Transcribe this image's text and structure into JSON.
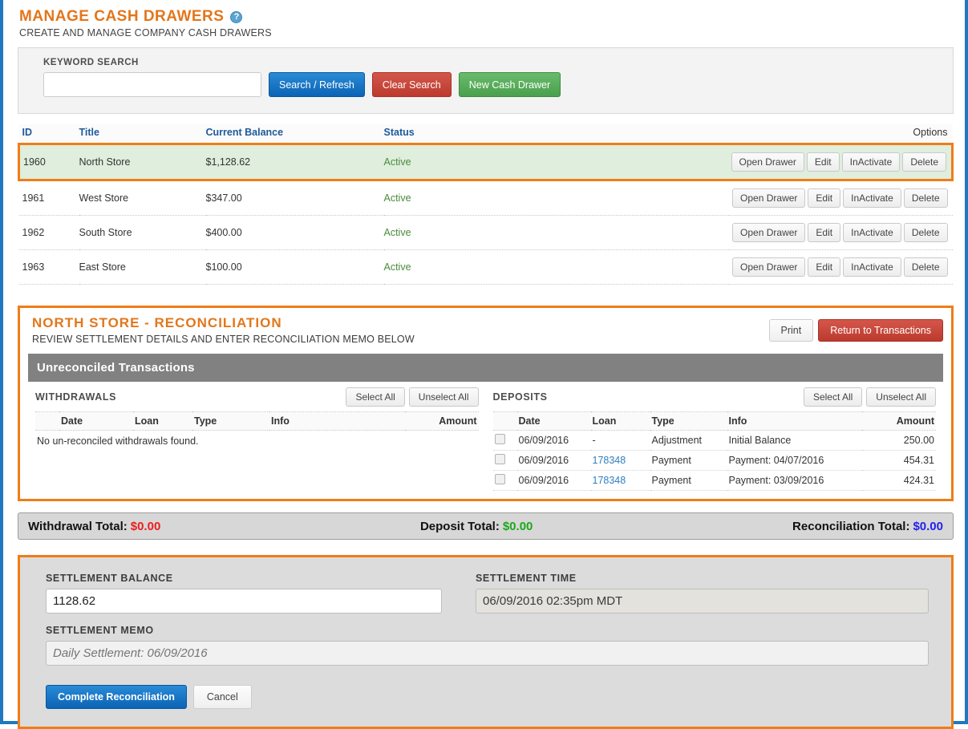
{
  "header": {
    "title": "MANAGE CASH DRAWERS",
    "help_icon": "help-circle-icon",
    "subtitle": "CREATE AND MANAGE COMPANY CASH DRAWERS"
  },
  "search": {
    "label": "KEYWORD SEARCH",
    "value": "",
    "placeholder": "",
    "buttons": {
      "search": "Search / Refresh",
      "clear": "Clear Search",
      "new": "New Cash Drawer"
    }
  },
  "drawers_table": {
    "columns": [
      "ID",
      "Title",
      "Current Balance",
      "Status",
      "Options"
    ],
    "row_actions": [
      "Open Drawer",
      "Edit",
      "InActivate",
      "Delete"
    ],
    "rows": [
      {
        "id": "1960",
        "title": "North Store",
        "balance": "$1,128.62",
        "status": "Active",
        "selected": true
      },
      {
        "id": "1961",
        "title": "West Store",
        "balance": "$347.00",
        "status": "Active",
        "selected": false
      },
      {
        "id": "1962",
        "title": "South Store",
        "balance": "$400.00",
        "status": "Active",
        "selected": false
      },
      {
        "id": "1963",
        "title": "East Store",
        "balance": "$100.00",
        "status": "Active",
        "selected": false
      }
    ]
  },
  "reconciliation": {
    "title": "NORTH STORE - RECONCILIATION",
    "subtitle": "REVIEW SETTLEMENT DETAILS AND ENTER RECONCILIATION MEMO BELOW",
    "print_label": "Print",
    "return_label": "Return to Transactions",
    "section_header": "Unreconciled Transactions",
    "withdrawals": {
      "title": "WITHDRAWALS",
      "select_all": "Select All",
      "unselect_all": "Unselect All",
      "columns": [
        "Date",
        "Loan",
        "Type",
        "Info",
        "Amount"
      ],
      "empty_message": "No un-reconciled withdrawals found.",
      "rows": []
    },
    "deposits": {
      "title": "DEPOSITS",
      "select_all": "Select All",
      "unselect_all": "Unselect All",
      "columns": [
        "Date",
        "Loan",
        "Type",
        "Info",
        "Amount"
      ],
      "rows": [
        {
          "checked": false,
          "date": "06/09/2016",
          "loan": "-",
          "loan_link": false,
          "type": "Adjustment",
          "info": "Initial Balance",
          "amount": "250.00"
        },
        {
          "checked": false,
          "date": "06/09/2016",
          "loan": "178348",
          "loan_link": true,
          "type": "Payment",
          "info": "Payment: 04/07/2016",
          "amount": "454.31"
        },
        {
          "checked": false,
          "date": "06/09/2016",
          "loan": "178348",
          "loan_link": true,
          "type": "Payment",
          "info": "Payment: 03/09/2016",
          "amount": "424.31"
        }
      ]
    }
  },
  "totals": {
    "withdrawal_label": "Withdrawal Total:",
    "withdrawal_value": "$0.00",
    "deposit_label": "Deposit Total:",
    "deposit_value": "$0.00",
    "reconciliation_label": "Reconciliation Total:",
    "reconciliation_value": "$0.00"
  },
  "settlement": {
    "balance_label": "SETTLEMENT BALANCE",
    "balance_value": "1128.62",
    "time_label": "SETTLEMENT TIME",
    "time_value": "06/09/2016 02:35pm MDT",
    "memo_label": "SETTLEMENT MEMO",
    "memo_value": "",
    "memo_placeholder": "Daily Settlement: 06/09/2016",
    "complete_label": "Complete Reconciliation",
    "cancel_label": "Cancel"
  },
  "colors": {
    "accent_orange": "#ef7d18",
    "title_orange": "#e3761b",
    "page_border_blue": "#1f78c1",
    "link_blue": "#1e5a99",
    "status_green": "#4a8a3c",
    "total_red": "#ee1c1c",
    "total_green": "#1ba81b",
    "total_blue": "#2222ee",
    "section_grey": "#818181"
  }
}
